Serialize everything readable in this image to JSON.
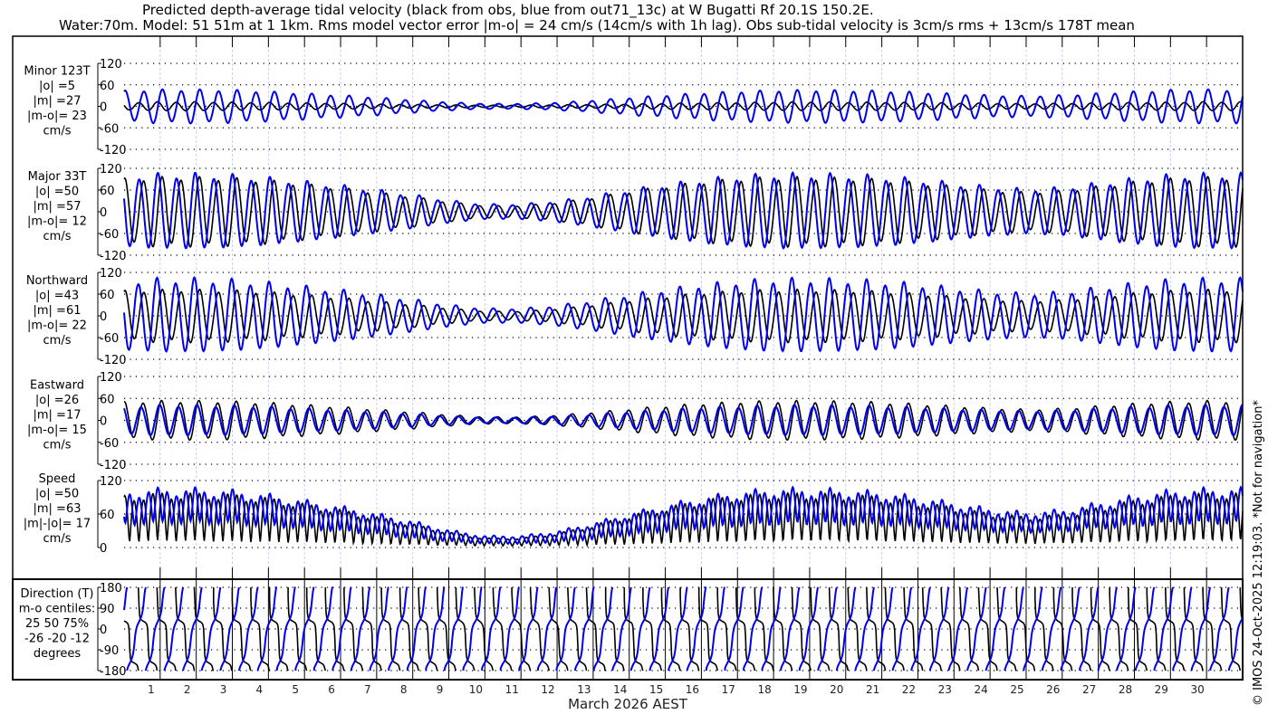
{
  "title": {
    "line1": "Predicted depth-average tidal velocity (black from obs, blue from out71_13c) at W Bugatti Rf 20.1S 150.2E.",
    "line2": "Water:70m. Model: 51 51m at 1 1km. Rms model vector error |m-o| = 24 cm/s (14cm/s with 1h lag). Obs sub-tidal velocity is 3cm/s rms + 13cm/s 178T mean"
  },
  "copyright": "© IMOS 24-Oct-2025 12:19:03. *Not for navigation*",
  "colors": {
    "obs": "#000000",
    "model": "#0000ee",
    "grid": "#c8d0ee"
  },
  "chart_data": {
    "type": "line",
    "xlabel": "March 2026 AEST",
    "x_unit": "day of month",
    "xlim": [
      0,
      31
    ],
    "day_labels": [
      "1",
      "2",
      "3",
      "4",
      "5",
      "6",
      "7",
      "8",
      "9",
      "10",
      "11",
      "12",
      "13",
      "14",
      "15",
      "16",
      "17",
      "18",
      "19",
      "20",
      "21",
      "22",
      "23",
      "24",
      "25",
      "26",
      "27",
      "28",
      "29",
      "30"
    ],
    "tidal_period_days": 0.5175,
    "major_axis_T": 33,
    "envelope_days": [
      0,
      1,
      2,
      3,
      4,
      5,
      6,
      7,
      8,
      9,
      10,
      11,
      12,
      13,
      14,
      15,
      16,
      17,
      18,
      19,
      20,
      21,
      22,
      23,
      24,
      25,
      26,
      27,
      28,
      29,
      30,
      31
    ],
    "envelopes": {
      "model_major": [
        95,
        100,
        100,
        97,
        90,
        80,
        70,
        58,
        45,
        30,
        20,
        20,
        28,
        42,
        58,
        72,
        85,
        94,
        100,
        100,
        98,
        94,
        86,
        76,
        66,
        60,
        64,
        76,
        88,
        97,
        100,
        100
      ],
      "obs_major": [
        88,
        92,
        92,
        90,
        84,
        74,
        64,
        52,
        40,
        26,
        16,
        16,
        24,
        38,
        54,
        68,
        80,
        88,
        92,
        92,
        90,
        86,
        78,
        68,
        58,
        52,
        56,
        68,
        80,
        88,
        92,
        92
      ],
      "model_minor": [
        42,
        45,
        45,
        44,
        40,
        35,
        30,
        24,
        17,
        11,
        7,
        7,
        10,
        16,
        23,
        30,
        36,
        40,
        43,
        44,
        43,
        42,
        38,
        34,
        30,
        28,
        30,
        35,
        40,
        44,
        45,
        45
      ],
      "obs_minor": [
        10,
        12,
        12,
        11,
        10,
        9,
        8,
        6,
        5,
        4,
        3,
        3,
        4,
        5,
        6,
        8,
        9,
        10,
        11,
        12,
        11,
        11,
        10,
        9,
        8,
        7,
        8,
        9,
        10,
        11,
        12,
        12
      ]
    },
    "panels": [
      {
        "id": "minor",
        "name": "Minor 123T",
        "stats": [
          "|o| =5",
          "|m| =27",
          "|m-o|= 23",
          "cm/s"
        ],
        "ylim": [
          -120,
          120
        ],
        "yticks": [
          "120",
          "60",
          "0",
          "-60",
          "-120"
        ],
        "ytick_values": [
          120,
          60,
          0,
          -60,
          -120
        ]
      },
      {
        "id": "major",
        "name": "Major 33T",
        "stats": [
          "|o| =50",
          "|m| =57",
          "|m-o|= 12",
          "cm/s"
        ],
        "ylim": [
          -120,
          120
        ],
        "yticks": [
          "120",
          "60",
          "0",
          "-60",
          "-120"
        ],
        "ytick_values": [
          120,
          60,
          0,
          -60,
          -120
        ]
      },
      {
        "id": "north",
        "name": "Northward",
        "stats": [
          "|o| =43",
          "|m| =61",
          "|m-o|= 22",
          "cm/s"
        ],
        "ylim": [
          -120,
          120
        ],
        "yticks": [
          "120",
          "60",
          "0",
          "-60",
          "-120"
        ],
        "ytick_values": [
          120,
          60,
          0,
          -60,
          -120
        ]
      },
      {
        "id": "east",
        "name": "Eastward",
        "stats": [
          "|o| =26",
          "|m| =17",
          "|m-o|= 15",
          "cm/s"
        ],
        "ylim": [
          -120,
          120
        ],
        "yticks": [
          "120",
          "60",
          "0",
          "-60",
          "-120"
        ],
        "ytick_values": [
          120,
          60,
          0,
          -60,
          -120
        ]
      },
      {
        "id": "speed",
        "name": "Speed",
        "stats": [
          "|o| =50",
          "|m| =63",
          "|m|-|o|= 17",
          "cm/s"
        ],
        "ylim": [
          0,
          120
        ],
        "yticks": [
          "120",
          "60",
          "0"
        ],
        "ytick_values": [
          120,
          60,
          0
        ]
      },
      {
        "id": "dir",
        "name": "Direction (T)",
        "stats": [
          "m-o centiles:",
          "25  50  75%",
          "-26 -20 -12",
          "degrees"
        ],
        "ylim": [
          -180,
          180
        ],
        "yticks": [
          "180",
          "90",
          "0",
          "-90",
          "-180"
        ],
        "ytick_values": [
          180,
          90,
          0,
          -90,
          -180
        ]
      }
    ]
  }
}
